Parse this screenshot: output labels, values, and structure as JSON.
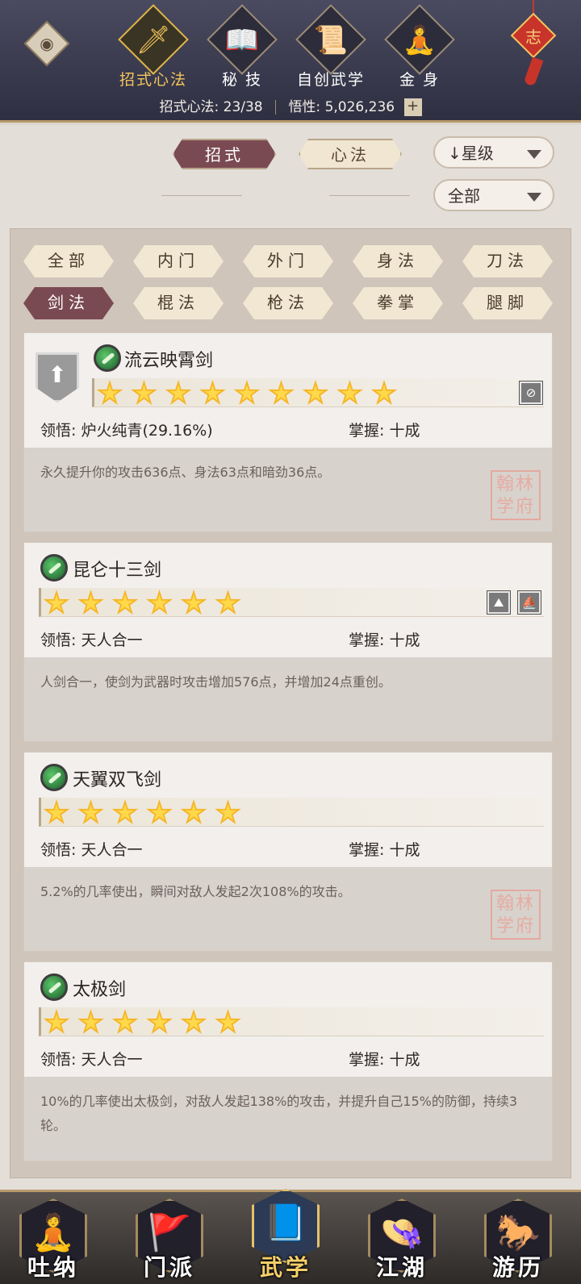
{
  "header": {
    "tabs": [
      {
        "label": "招式心法",
        "icon": "sword-icon"
      },
      {
        "label": "秘 技",
        "icon": "book-icon"
      },
      {
        "label": "自创武学",
        "icon": "scroll-icon"
      },
      {
        "label": "金 身",
        "icon": "meditation-icon"
      }
    ],
    "stat_label_1": "招式心法: 23/38",
    "stat_label_2": "悟性: 5,026,236",
    "plus": "+",
    "knot_char": "志"
  },
  "toggle": {
    "zhaoshi": "招式",
    "xinfa": "心法"
  },
  "sort": {
    "label": "↓星级"
  },
  "filter": {
    "label": "全部"
  },
  "categories": [
    {
      "label": "全部"
    },
    {
      "label": "内门"
    },
    {
      "label": "外门"
    },
    {
      "label": "身法"
    },
    {
      "label": "刀法"
    },
    {
      "label": "剑法"
    },
    {
      "label": "棍法"
    },
    {
      "label": "枪法"
    },
    {
      "label": "拳掌"
    },
    {
      "label": "腿脚"
    }
  ],
  "skills": [
    {
      "name": "流云映霄剑",
      "stars": 9,
      "comprehension": "领悟: 炉火纯青(29.16%)",
      "mastery": "掌握: 十成",
      "description": "永久提升你的攻击636点、身法63点和暗劲36点。",
      "seal": "翰林\n学府"
    },
    {
      "name": "昆仑十三剑",
      "stars": 6,
      "comprehension": "领悟: 天人合一",
      "mastery": "掌握: 十成",
      "description": "人剑合一，使剑为武器时攻击增加576点，并增加24点重创。"
    },
    {
      "name": "天翼双飞剑",
      "stars": 6,
      "comprehension": "领悟: 天人合一",
      "mastery": "掌握: 十成",
      "description": "5.2%的几率使出，瞬间对敌人发起2次108%的攻击。",
      "seal": "翰林\n学府"
    },
    {
      "name": "太极剑",
      "stars": 6,
      "comprehension": "领悟: 天人合一",
      "mastery": "掌握: 十成",
      "description": "10%的几率使出太极剑，对敌人发起138%的攻击，并提升自己15%的防御，持续3轮。"
    }
  ],
  "bottom_nav": [
    {
      "label": "吐纳",
      "icon": "monk-icon"
    },
    {
      "label": "门派",
      "icon": "banner-icon"
    },
    {
      "label": "武学",
      "icon": "book-icon"
    },
    {
      "label": "江湖",
      "icon": "hat-icon"
    },
    {
      "label": "游历",
      "icon": "horse-icon"
    }
  ],
  "colors": {
    "active_pill": "#7a4a53",
    "star": "#f5b526",
    "header_bg": "#3a3a4e"
  }
}
